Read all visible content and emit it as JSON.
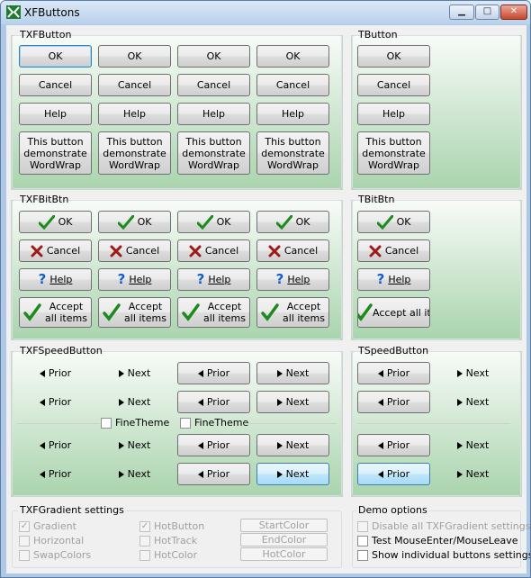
{
  "window": {
    "title": "XFButtons",
    "caption_min": "▁",
    "caption_max": "□",
    "caption_close": "✕"
  },
  "groups": {
    "txfbutton": "TXFButton",
    "tbutton": "TButton",
    "txfbitbtn": "TXFBitBtn",
    "tbitbtn": "TBitBtn",
    "txfspeedbutton": "TXFSpeedButton",
    "tspeedbutton": "TSpeedButton",
    "gradient_settings": "TXFGradient settings",
    "demo_options": "Demo options"
  },
  "labels": {
    "ok": "OK",
    "cancel": "Cancel",
    "help": "Help",
    "wordwrap": "This button demonstrate WordWrap",
    "bit_ok": "OK",
    "bit_cancel": "Cancel",
    "bit_help": "Help",
    "accept": "Accept all items",
    "accept_cut": "Accept all iten",
    "prior": "Prior",
    "next": "Next",
    "finetheme": "FineTheme"
  },
  "settings": {
    "gradient": "Gradient",
    "horizontal": "Horizontal",
    "swapcolors": "SwapColors",
    "hotbutton": "HotButton",
    "hottrack": "HotTrack",
    "hotcolor_chk": "HotColor",
    "startcolor": "StartColor",
    "endcolor": "EndColor",
    "hotcolor_btn": "HotColor"
  },
  "demo": {
    "disable": "Disable all TXFGradient settings",
    "test": "Test MouseEnter/MouseLeave",
    "show": "Show individual buttons settings"
  },
  "icons": [
    "check-icon",
    "cross-icon",
    "question-icon",
    "arrow-left-icon",
    "arrow-right-icon"
  ],
  "colors": {
    "panel_top": "#f8fbf8",
    "panel_bottom": "#a9d4ad",
    "hot_blue": "#a7d9f5"
  }
}
